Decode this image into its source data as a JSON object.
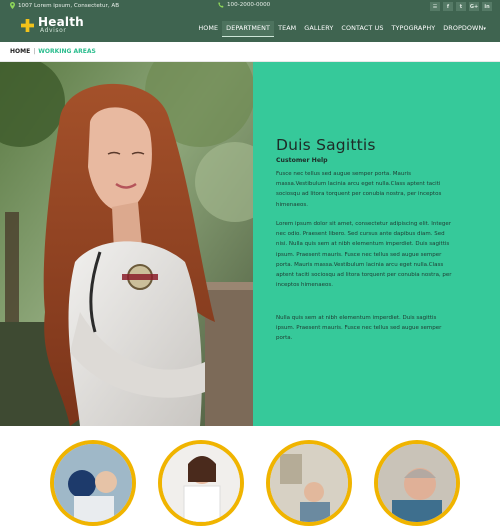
{
  "topbar": {
    "address": "1007 Lorem ipsum, Consectetur, AB",
    "phone": "100-2000-0000",
    "social": [
      {
        "icon": "rss-icon",
        "glyph": "☰"
      },
      {
        "icon": "facebook-icon",
        "glyph": "f"
      },
      {
        "icon": "twitter-icon",
        "glyph": "t"
      },
      {
        "icon": "google-plus-icon",
        "glyph": "G+"
      },
      {
        "icon": "linkedin-icon",
        "glyph": "in"
      }
    ]
  },
  "logo": {
    "title": "Health",
    "subtitle": "Advisor"
  },
  "nav": {
    "items": [
      {
        "label": "HOME",
        "active": false
      },
      {
        "label": "DEPARTMENT",
        "active": true
      },
      {
        "label": "TEAM",
        "active": false
      },
      {
        "label": "GALLERY",
        "active": false
      },
      {
        "label": "CONTACT US",
        "active": false
      },
      {
        "label": "TYPOGRAPHY",
        "active": false
      },
      {
        "label": "DROPDOWN",
        "active": false
      }
    ],
    "dropdown_caret": "▾"
  },
  "breadcrumb": {
    "home": "HOME",
    "separator": "|",
    "current": "WORKING AREAS"
  },
  "hero": {
    "title": "Duis Sagittis",
    "subtitle": "Customer Help",
    "paragraphs": [
      "Fusce nec tellus sed augue semper porta. Mauris massa.Vestibulum lacinia arcu eget nulla.Class aptent taciti sociosqu ad litora torquent per conubia nostra, per inceptos himenaeos.",
      "Lorem ipsum dolor sit amet, consectetur adipiscing elit. Integer nec odio. Praesent libero. Sed cursus ante dapibus diam. Sed nisi. Nulla quis sem at nibh elementum imperdiet. Duis sagittis ipsum. Praesent mauris. Fusce nec tellus sed augue semper porta. Mauris massa.Vestibulum lacinia arcu eget nulla.Class aptent taciti sociosqu ad litora torquent per conubia nostra, per inceptos himenaeos.",
      "Nulla quis sem at nibh elementum imperdiet. Duis sagittis ipsum. Praesent mauris. Fusce nec tellus sed augue semper porta."
    ]
  },
  "colors": {
    "header_bg": "#3f6450",
    "panel_bg": "#36c99a",
    "accent_green": "#2bbd8e",
    "ring_yellow": "#f0b400"
  }
}
